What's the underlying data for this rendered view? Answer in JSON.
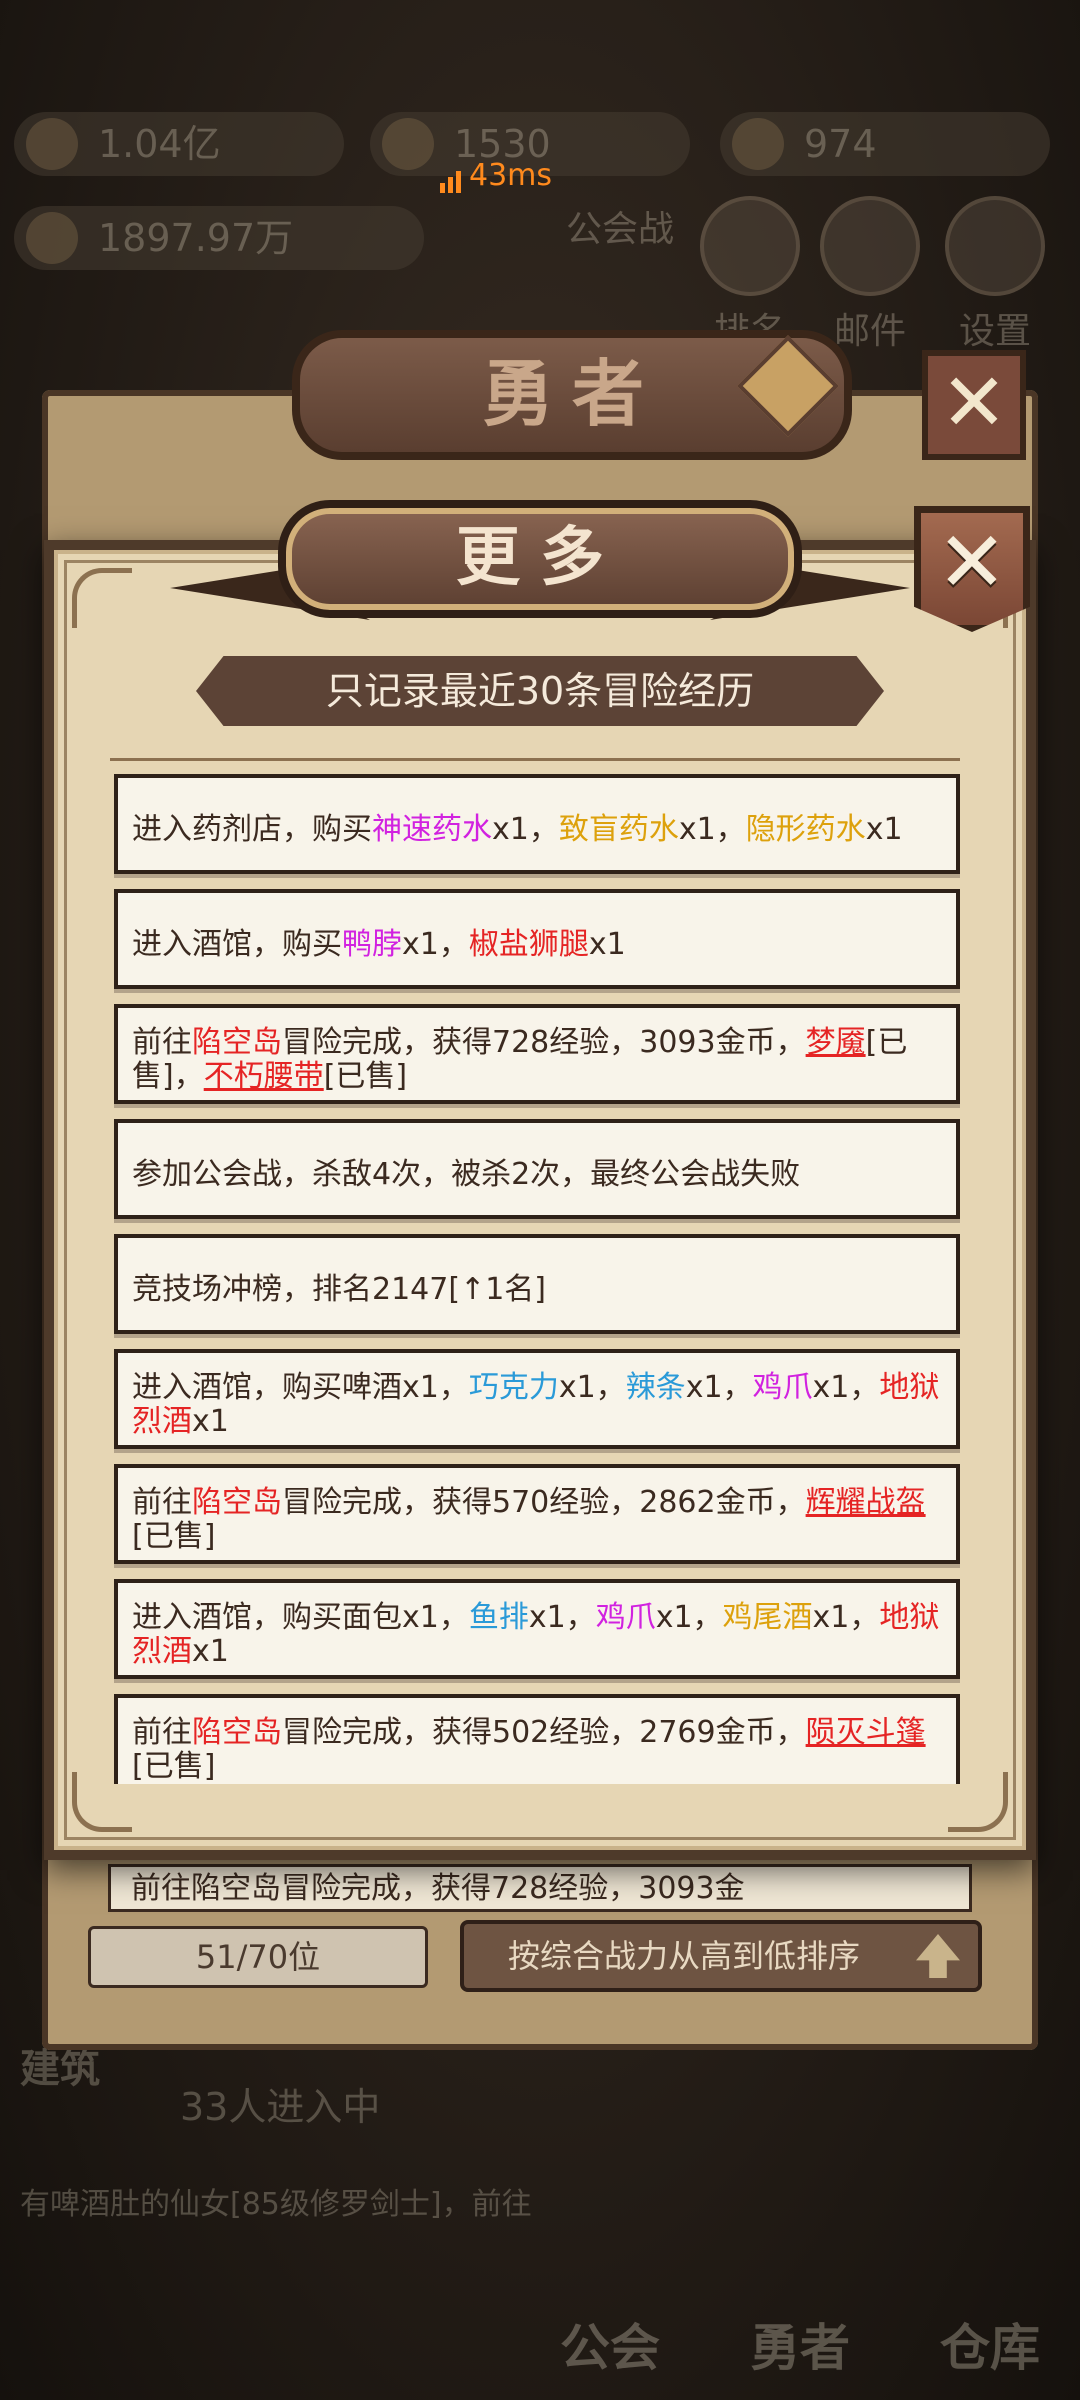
{
  "hud": {
    "gold": "1.04亿",
    "gems": "1530",
    "stamina": "974",
    "power": "1897.97万",
    "ping": "43ms",
    "buttons": {
      "guild_war": "公会战",
      "rank": "排名",
      "mail": "邮件",
      "settings": "设置"
    }
  },
  "back_panel": {
    "title": "勇者",
    "peek_row": "前往陷空岛冒险完成，获得728经验，3093金",
    "rank_position": "51/70位",
    "sort_label": "按综合战力从高到低排序"
  },
  "bottom_nav": {
    "guild": "公会",
    "hero": "勇者",
    "warehouse": "仓库"
  },
  "bottom_info": {
    "building": "建筑",
    "boss_line": "33人进入中",
    "text": "有啤酒肚的仙女[85级修罗剑士]，前往"
  },
  "dialog": {
    "title": "更多",
    "close_label": "✕",
    "subtitle": "只记录最近30条冒险经历",
    "colors": {
      "purple": "#d122e0",
      "gold": "#dda10c",
      "red": "#e52424",
      "blue": "#2a9ad8"
    },
    "log": [
      {
        "segments": [
          {
            "t": "进入药剂店，购买",
            "c": ""
          },
          {
            "t": "神速药水",
            "c": "purple"
          },
          {
            "t": "x1，",
            "c": ""
          },
          {
            "t": "致盲药水",
            "c": "gold"
          },
          {
            "t": "x1，",
            "c": ""
          },
          {
            "t": "隐形药水",
            "c": "gold"
          },
          {
            "t": "x1",
            "c": ""
          }
        ]
      },
      {
        "segments": [
          {
            "t": "进入酒馆，购买",
            "c": ""
          },
          {
            "t": "鸭脖",
            "c": "purple"
          },
          {
            "t": "x1，",
            "c": ""
          },
          {
            "t": "椒盐狮腿",
            "c": "red"
          },
          {
            "t": "x1",
            "c": ""
          }
        ]
      },
      {
        "segments": [
          {
            "t": "前往",
            "c": ""
          },
          {
            "t": "陷空岛",
            "c": "red"
          },
          {
            "t": "冒险完成，获得728经验，3093金币，",
            "c": ""
          },
          {
            "t": "梦魇",
            "c": "red-u"
          },
          {
            "t": "[已售]，",
            "c": ""
          },
          {
            "t": "不朽腰带",
            "c": "red-u"
          },
          {
            "t": "[已售]",
            "c": ""
          }
        ]
      },
      {
        "segments": [
          {
            "t": "参加公会战，杀敌4次，被杀2次，最终公会战失败",
            "c": ""
          }
        ]
      },
      {
        "segments": [
          {
            "t": "竞技场冲榜，排名2147[↑1名]",
            "c": ""
          }
        ]
      },
      {
        "segments": [
          {
            "t": "进入酒馆，购买啤酒x1，",
            "c": ""
          },
          {
            "t": "巧克力",
            "c": "blue"
          },
          {
            "t": "x1，",
            "c": ""
          },
          {
            "t": "辣条",
            "c": "blue"
          },
          {
            "t": "x1，",
            "c": ""
          },
          {
            "t": "鸡爪",
            "c": "purple"
          },
          {
            "t": "x1，",
            "c": ""
          },
          {
            "t": "地狱烈酒",
            "c": "red"
          },
          {
            "t": "x1",
            "c": ""
          }
        ]
      },
      {
        "segments": [
          {
            "t": "前往",
            "c": ""
          },
          {
            "t": "陷空岛",
            "c": "red"
          },
          {
            "t": "冒险完成，获得570经验，2862金币，",
            "c": ""
          },
          {
            "t": "辉耀战盔",
            "c": "red-u"
          },
          {
            "t": "[已售]",
            "c": ""
          }
        ]
      },
      {
        "segments": [
          {
            "t": "进入酒馆，购买面包x1，",
            "c": ""
          },
          {
            "t": "鱼排",
            "c": "blue"
          },
          {
            "t": "x1，",
            "c": ""
          },
          {
            "t": "鸡爪",
            "c": "purple"
          },
          {
            "t": "x1，",
            "c": ""
          },
          {
            "t": "鸡尾酒",
            "c": "gold"
          },
          {
            "t": "x1，",
            "c": ""
          },
          {
            "t": "地狱烈酒",
            "c": "red"
          },
          {
            "t": "x1",
            "c": ""
          }
        ]
      },
      {
        "segments": [
          {
            "t": "前往",
            "c": ""
          },
          {
            "t": "陷空岛",
            "c": "red"
          },
          {
            "t": "冒险完成，获得502经验，2769金币，",
            "c": ""
          },
          {
            "t": "陨灭斗篷",
            "c": "red-u"
          },
          {
            "t": "[已售]",
            "c": ""
          }
        ]
      }
    ]
  }
}
